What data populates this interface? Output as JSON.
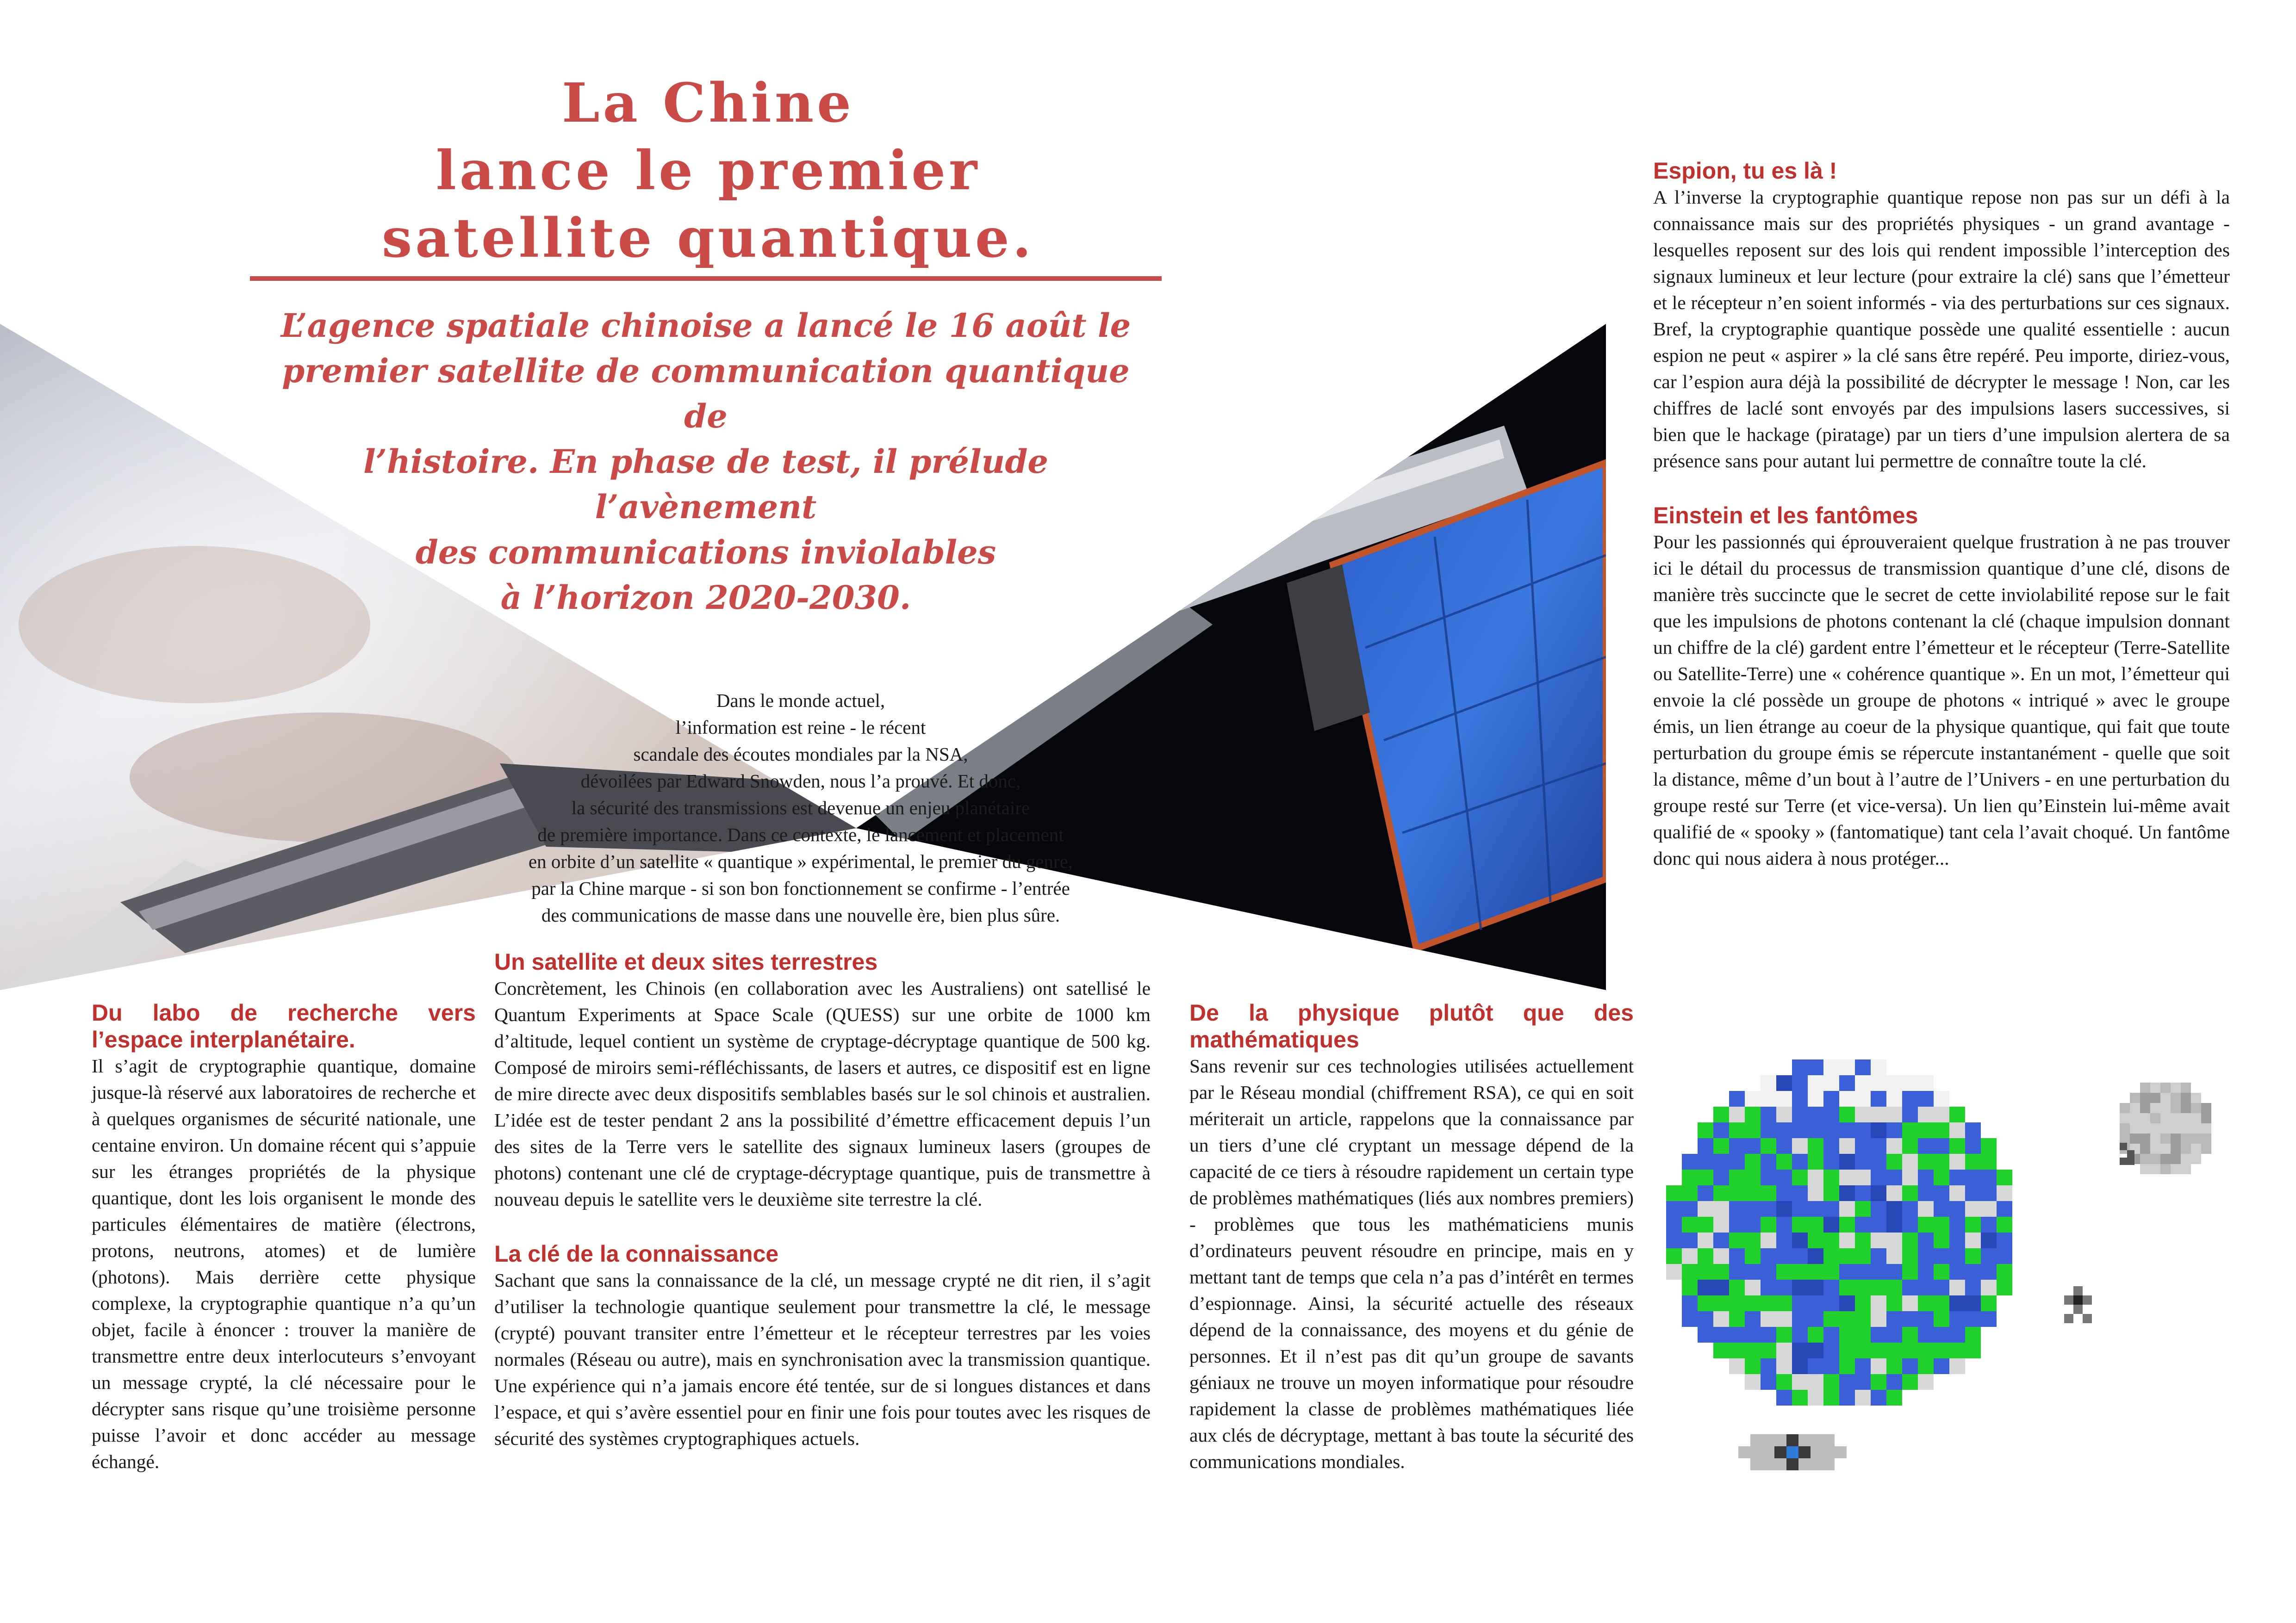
{
  "title": {
    "line1": "La Chine",
    "line2": "lance le premier",
    "line3": "satellite quantique."
  },
  "standfirst": {
    "line1": "L’agence spatiale chinoise a lancé le 16 août le",
    "line2": "premier satellite de communication quantique de",
    "line3": "l’histoire. En phase de test, il prélude l’avènement",
    "line4": "des communications inviolables",
    "line5": "à l’horizon 2020-2030."
  },
  "intro": {
    "l1": "Dans le monde actuel,",
    "l2": "l’information est reine - le récent",
    "l3": "scandale des écoutes mondiales par la NSA,",
    "l4": "dévoilées par Edward Snowden, nous l’a prouvé. Et donc,",
    "l5": "la sécurité des transmissions est devenue un enjeu planétaire",
    "l6": "de première importance. Dans ce contexte, le lancement et placement",
    "l7": "en orbite d’un satellite « quantique » expérimental, le premier du genre,",
    "l8": "par la Chine marque - si son bon fonctionnement se confirme - l’entrée",
    "l9": "des communications de masse dans une nouvelle ère, bien plus sûre."
  },
  "col1": {
    "heading": "Du labo de recherche vers l’espace interplanétaire.",
    "body": "Il s’agit de cryptographie quantique, domaine jusque-là réservé aux laboratoires de recherche et à quelques organismes de sécurité nationale, une centaine environ. Un domaine récent qui s’appuie sur les étranges propriétés de la physique quantique, dont les lois organisent le monde des particules élémentaires de matière (électrons, protons, neutrons, atomes) et de lumière (photons). Mais derrière cette physique complexe, la cryptographie quantique n’a qu’un objet, facile à énoncer : trouver la manière de transmettre entre deux interlocuteurs s’envoyant un message crypté, la clé nécessaire pour le décrypter sans risque qu’une troisième personne puisse l’avoir et donc accéder au message échangé."
  },
  "col2": {
    "heading1": "Un satellite et deux sites terrestres",
    "body1": "Concrètement, les Chinois (en collaboration avec les Australiens) ont satellisé le Quantum Experiments at Space Scale (QUESS) sur une orbite de 1000 km d’altitude, lequel contient un système de cryptage-décryptage quantique de 500 kg. Composé de miroirs semi-réfléchissants, de lasers et autres, ce dispositif est en ligne de mire directe avec deux dispositifs semblables basés sur le sol chinois et australien. L’idée est de tester pendant 2 ans la possibilité d’émettre efficacement depuis l’un des sites de la Terre vers le satellite des signaux lumineux lasers (groupes de photons) contenant une clé de cryptage-décryptage quantique, puis de transmettre à nouveau depuis le satellite vers le deuxième site terrestre la clé.",
    "heading2": "La clé de la connaissance",
    "body2": "Sachant que sans la connaissance de la clé, un message crypté ne dit rien, il s’agit d’utiliser la technologie quantique seulement pour transmettre la clé, le message (crypté) pouvant transiter entre l’émetteur et le récepteur terrestres par les voies normales (Réseau ou autre), mais en synchronisation avec la transmission quantique. Une expérience qui n’a jamais encore été tentée, sur de si longues distances et dans l’espace, et qui s’avère essentiel pour en finir une fois pour toutes avec les risques de sécurité des systèmes cryptographiques actuels."
  },
  "col3": {
    "heading": "De la physique plutôt que des mathématiques",
    "body": "Sans revenir sur ces technologies utilisées actuellement par le Réseau mondial (chiffrement RSA), ce qui en soit mériterait un article, rappelons que la connaissance par un tiers d’une clé cryptant un message dépend de la capacité de ce tiers à résoudre rapidement un certain type de problèmes mathématiques (liés aux nombres premiers) - problèmes que tous les mathématiciens munis d’ordinateurs peuvent résoudre en principe, mais en y mettant tant de temps que cela n’a pas d’intérêt en termes d’espionnage. Ainsi, la sécurité actuelle des réseaux dépend de la connaissance, des moyens et du génie de personnes. Et il n’est pas dit qu’un groupe de savants géniaux ne trouve un moyen informatique pour résoudre rapidement la classe de problèmes mathématiques liée aux clés de décryptage, mettant à bas toute la sécurité des communications mondiales."
  },
  "col4": {
    "heading1": "Espion, tu es là !",
    "body1": "A l’inverse la cryptographie quantique repose non pas sur un défi à la connaissance mais sur des propriétés physiques - un grand avantage - lesquelles reposent sur des lois qui rendent impossible l’interception des signaux lumineux et leur lecture (pour extraire la clé) sans que l’émetteur et le récepteur n’en soient informés - via des perturbations sur ces signaux. Bref, la cryptographie quantique possède une qualité essentielle : aucun espion ne peut « aspirer » la clé sans être repéré. Peu importe, diriez-vous, car l’espion aura déjà la possibilité de décrypter le message ! Non, car les chiffres de laclé sont envoyés par des impulsions lasers successives, si bien que le hackage (piratage) par un tiers d’une impulsion alertera de sa présence sans pour autant lui permettre de connaître toute la clé.",
    "heading2": "Einstein et les fantômes",
    "body2": "Pour les passionnés qui éprouveraient quelque frustration à ne pas trouver ici le détail du processus de transmission quantique d’une clé, disons de manière très succincte que le secret de cette inviolabilité repose sur le fait que les impulsions de photons contenant la clé (chaque impulsion donnant un chiffre de la clé) gardent entre l’émetteur et le récepteur (Terre-Satellite ou Satellite-Terre) une « cohérence quantique ». En un mot, l’émetteur qui envoie la clé possède un groupe de photons « intriqué » avec le groupe émis, un lien étrange au coeur de la physique quantique, qui fait que toute perturbation du groupe émis se répercute instantanément - quelle que soit la distance, même d’un bout à l’autre de l’Univers - en une perturbation du groupe resté sur Terre (et vice-versa). Un lien qu’Einstein lui-même avait qualifié de « spooky » (fantomatique) tant cela l’avait choqué. Un fantôme donc qui nous aidera à nous protéger..."
  },
  "colors": {
    "accent": "#c94a47",
    "heading": "#c0312e",
    "pixel_ocean": "#3a5fd6",
    "pixel_land": "#1fd12a"
  }
}
